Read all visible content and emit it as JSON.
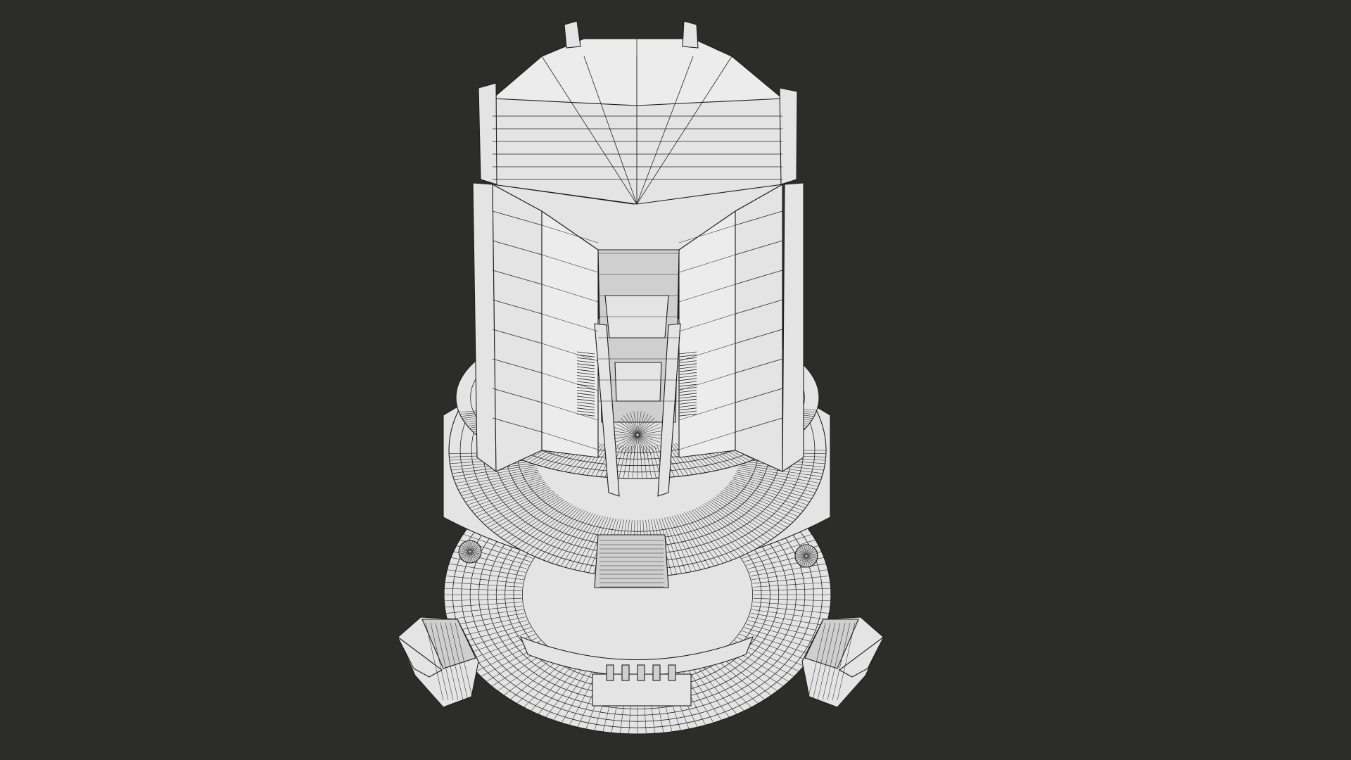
{
  "viewport": {
    "background_color": "#2c2c2b",
    "model_surface_color": "#e4e4e4",
    "wireframe_color": "#1e1e1e"
  }
}
